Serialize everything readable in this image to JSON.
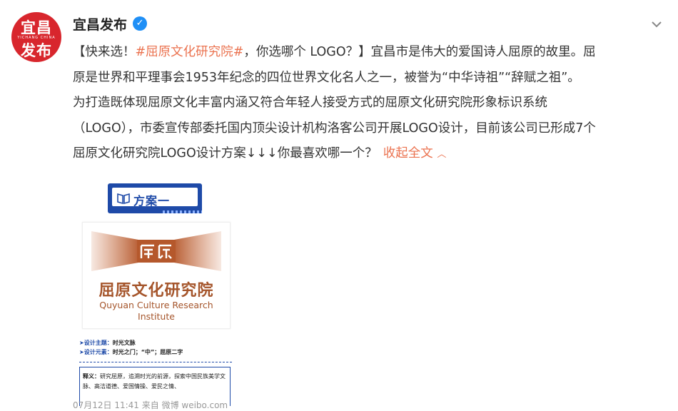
{
  "user": {
    "name": "宜昌发布",
    "avatar_line1": "宜昌",
    "avatar_sub": "YICHANG CHINA",
    "avatar_line2": "发布",
    "verified_icon": "verified-check-icon"
  },
  "post": {
    "lines": [
      [
        "【快来选！",
        "#屈原文化研究院#",
        "，你选哪个 LOGO？】宜昌市是伟大的爱国诗人屈原的故里。屈"
      ],
      [
        "原是世界和平理事会1953年纪念的四位世界文化名人之一，被誉为“中华诗祖”“辞赋之祖”。"
      ],
      [
        "为打造既体现屈原文化丰富内涵又符合年轻人接受方式的屈原文化研究院形象标识系统"
      ],
      [
        "（LOGO），市委宣传部委托国内顶尖设计机构洛客公司开展LOGO设计，目前该公司已形成7个"
      ],
      [
        "屈原文化研究院LOGO设计方案↓↓↓你最喜欢哪一个？"
      ]
    ],
    "collapse_label": "收起全文",
    "collapse_icon": "chevron-up-icon"
  },
  "attachment": {
    "plan_label": "方案一",
    "logo_name_cn": "屈原文化研究院",
    "logo_name_en_1": "Quyuan Culture Research",
    "logo_name_en_2": "Institute",
    "theme_key": "➤设计主题：",
    "theme_value": "时光文脉",
    "elements_key": "➤设计元素：",
    "elements_value": "时光之门；“中”；屈原二字",
    "explain_key": "释义：",
    "explain_text": "研究屈原，追溯时光的前源，探索中国民族美学文脉、高洁道德、爱国情操、爱民之情、"
  },
  "footer": {
    "meta": "07月12日 11:41  来自 微博 weibo.com"
  },
  "colors": {
    "link": "#eb7350",
    "badge_blue": "#1e4aa8",
    "logo_brown": "#a5552b",
    "avatar_red": "#d8262d"
  }
}
